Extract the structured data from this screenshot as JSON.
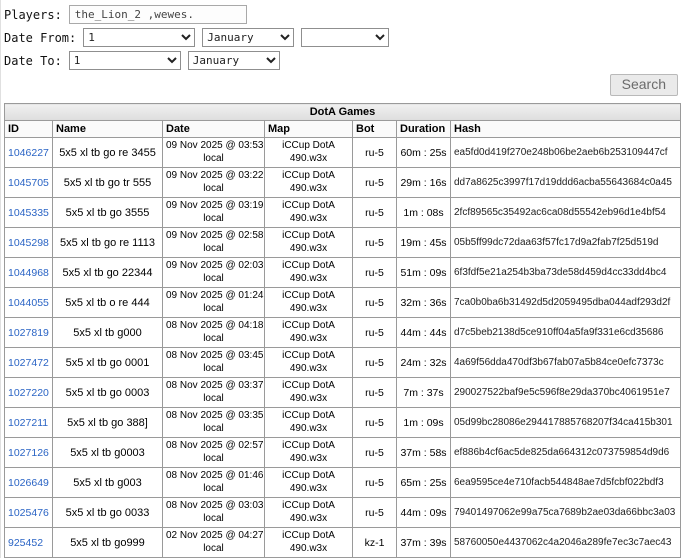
{
  "colors": {
    "link": "#2a64c5"
  },
  "form": {
    "players_label": "Players:",
    "players_value": "the_Lion_2 ,wewes.",
    "date_from_label": "Date From:",
    "date_to_label": "Date To:",
    "date_from": {
      "day": "1",
      "month": "January",
      "year": ""
    },
    "date_to": {
      "day": "1",
      "month": "January"
    },
    "search_label": "Search"
  },
  "table": {
    "title": "DotA Games",
    "columns": [
      "ID",
      "Name",
      "Date",
      "Map",
      "Bot",
      "Duration",
      "Hash"
    ],
    "rows": [
      {
        "id": "1046227",
        "name": "5x5 xl tb go re 3455",
        "date": "09 Nov 2025 @ 03:53",
        "date_sub": "local",
        "map": "iCCup DotA",
        "map_sub": "490.w3x",
        "bot": "ru-5",
        "duration": "60m : 25s",
        "hash": "ea5fd0d419f270e248b06be2aeb6b253109447cf"
      },
      {
        "id": "1045705",
        "name": "5x5 xl tb go tr 555",
        "date": "09 Nov 2025 @ 03:22",
        "date_sub": "local",
        "map": "iCCup DotA",
        "map_sub": "490.w3x",
        "bot": "ru-5",
        "duration": "29m : 16s",
        "hash": "dd7a8625c3997f17d19ddd6acba55643684c0a45"
      },
      {
        "id": "1045335",
        "name": "5x5 xl tb go 3555",
        "date": "09 Nov 2025 @ 03:19",
        "date_sub": "local",
        "map": "iCCup DotA",
        "map_sub": "490.w3x",
        "bot": "ru-5",
        "duration": "1m : 08s",
        "hash": "2fcf89565c35492ac6ca08d55542eb96d1e4bf54"
      },
      {
        "id": "1045298",
        "name": "5x5 xl tb go re 1113",
        "date": "09 Nov 2025 @ 02:58",
        "date_sub": "local",
        "map": "iCCup DotA",
        "map_sub": "490.w3x",
        "bot": "ru-5",
        "duration": "19m : 45s",
        "hash": "05b5ff99dc72daa63f57fc17d9a2fab7f25d519d"
      },
      {
        "id": "1044968",
        "name": "5x5 xl tb go 22344",
        "date": "09 Nov 2025 @ 02:03",
        "date_sub": "local",
        "map": "iCCup DotA",
        "map_sub": "490.w3x",
        "bot": "ru-5",
        "duration": "51m : 09s",
        "hash": "6f3fdf5e21a254b3ba73de58d459d4cc33dd4bc4"
      },
      {
        "id": "1044055",
        "name": "5x5 xl tb o re 444",
        "date": "09 Nov 2025 @ 01:24",
        "date_sub": "local",
        "map": "iCCup DotA",
        "map_sub": "490.w3x",
        "bot": "ru-5",
        "duration": "32m : 36s",
        "hash": "7ca0b0ba6b31492d5d2059495dba044adf293d2f"
      },
      {
        "id": "1027819",
        "name": "5x5 xl tb g000",
        "date": "08 Nov 2025 @ 04:18",
        "date_sub": "local",
        "map": "iCCup DotA",
        "map_sub": "490.w3x",
        "bot": "ru-5",
        "duration": "44m : 44s",
        "hash": "d7c5beb2138d5ce910ff04a5fa9f331e6cd35686"
      },
      {
        "id": "1027472",
        "name": "5x5 xl tb go 0001",
        "date": "08 Nov 2025 @ 03:45",
        "date_sub": "local",
        "map": "iCCup DotA",
        "map_sub": "490.w3x",
        "bot": "ru-5",
        "duration": "24m : 32s",
        "hash": "4a69f56dda470df3b67fab07a5b84ce0efc7373c"
      },
      {
        "id": "1027220",
        "name": "5x5 xl tb go 0003",
        "date": "08 Nov 2025 @ 03:37",
        "date_sub": "local",
        "map": "iCCup DotA",
        "map_sub": "490.w3x",
        "bot": "ru-5",
        "duration": "7m : 37s",
        "hash": "290027522baf9e5c596f8e29da370bc4061951e7"
      },
      {
        "id": "1027211",
        "name": "5x5 xl tb go 388]",
        "date": "08 Nov 2025 @ 03:35",
        "date_sub": "local",
        "map": "iCCup DotA",
        "map_sub": "490.w3x",
        "bot": "ru-5",
        "duration": "1m : 09s",
        "hash": "05d99bc28086e294417885768207f34ca415b301"
      },
      {
        "id": "1027126",
        "name": "5x5 xl tb g0003",
        "date": "08 Nov 2025 @ 02:57",
        "date_sub": "local",
        "map": "iCCup DotA",
        "map_sub": "490.w3x",
        "bot": "ru-5",
        "duration": "37m : 58s",
        "hash": "ef886b4cf6ac5de825da664312c073759854d9d6"
      },
      {
        "id": "1026649",
        "name": "5x5 xl tb g003",
        "date": "08 Nov 2025 @ 01:46",
        "date_sub": "local",
        "map": "iCCup DotA",
        "map_sub": "490.w3x",
        "bot": "ru-5",
        "duration": "65m : 25s",
        "hash": "6ea9595ce4e710facb544848ae7d5fcbf022bdf3"
      },
      {
        "id": "1025476",
        "name": "5x5 xl tb go 0033",
        "date": "08 Nov 2025 @ 03:03",
        "date_sub": "local",
        "map": "iCCup DotA",
        "map_sub": "490.w3x",
        "bot": "ru-5",
        "duration": "44m : 09s",
        "hash": "79401497062e99a75ca7689b2ae03da66bbc3a03"
      },
      {
        "id": "925452",
        "name": "5x5 xl tb go999",
        "date": "02 Nov 2025 @ 04:27",
        "date_sub": "local",
        "map": "iCCup DotA",
        "map_sub": "490.w3x",
        "bot": "kz-1",
        "duration": "37m : 39s",
        "hash": "58760050e4437062c4a2046a289fe7ec3c7aec43"
      }
    ]
  }
}
